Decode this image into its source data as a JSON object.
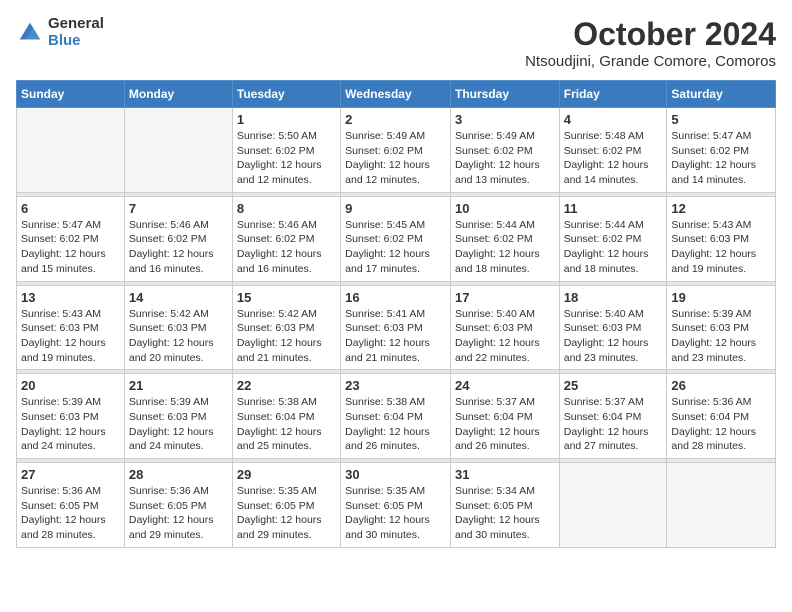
{
  "header": {
    "logo_general": "General",
    "logo_blue": "Blue",
    "month_title": "October 2024",
    "location": "Ntsoudjini, Grande Comore, Comoros"
  },
  "weekdays": [
    "Sunday",
    "Monday",
    "Tuesday",
    "Wednesday",
    "Thursday",
    "Friday",
    "Saturday"
  ],
  "weeks": [
    [
      {
        "day": "",
        "info": ""
      },
      {
        "day": "",
        "info": ""
      },
      {
        "day": "1",
        "info": "Sunrise: 5:50 AM\nSunset: 6:02 PM\nDaylight: 12 hours and 12 minutes."
      },
      {
        "day": "2",
        "info": "Sunrise: 5:49 AM\nSunset: 6:02 PM\nDaylight: 12 hours and 12 minutes."
      },
      {
        "day": "3",
        "info": "Sunrise: 5:49 AM\nSunset: 6:02 PM\nDaylight: 12 hours and 13 minutes."
      },
      {
        "day": "4",
        "info": "Sunrise: 5:48 AM\nSunset: 6:02 PM\nDaylight: 12 hours and 14 minutes."
      },
      {
        "day": "5",
        "info": "Sunrise: 5:47 AM\nSunset: 6:02 PM\nDaylight: 12 hours and 14 minutes."
      }
    ],
    [
      {
        "day": "6",
        "info": "Sunrise: 5:47 AM\nSunset: 6:02 PM\nDaylight: 12 hours and 15 minutes."
      },
      {
        "day": "7",
        "info": "Sunrise: 5:46 AM\nSunset: 6:02 PM\nDaylight: 12 hours and 16 minutes."
      },
      {
        "day": "8",
        "info": "Sunrise: 5:46 AM\nSunset: 6:02 PM\nDaylight: 12 hours and 16 minutes."
      },
      {
        "day": "9",
        "info": "Sunrise: 5:45 AM\nSunset: 6:02 PM\nDaylight: 12 hours and 17 minutes."
      },
      {
        "day": "10",
        "info": "Sunrise: 5:44 AM\nSunset: 6:02 PM\nDaylight: 12 hours and 18 minutes."
      },
      {
        "day": "11",
        "info": "Sunrise: 5:44 AM\nSunset: 6:02 PM\nDaylight: 12 hours and 18 minutes."
      },
      {
        "day": "12",
        "info": "Sunrise: 5:43 AM\nSunset: 6:03 PM\nDaylight: 12 hours and 19 minutes."
      }
    ],
    [
      {
        "day": "13",
        "info": "Sunrise: 5:43 AM\nSunset: 6:03 PM\nDaylight: 12 hours and 19 minutes."
      },
      {
        "day": "14",
        "info": "Sunrise: 5:42 AM\nSunset: 6:03 PM\nDaylight: 12 hours and 20 minutes."
      },
      {
        "day": "15",
        "info": "Sunrise: 5:42 AM\nSunset: 6:03 PM\nDaylight: 12 hours and 21 minutes."
      },
      {
        "day": "16",
        "info": "Sunrise: 5:41 AM\nSunset: 6:03 PM\nDaylight: 12 hours and 21 minutes."
      },
      {
        "day": "17",
        "info": "Sunrise: 5:40 AM\nSunset: 6:03 PM\nDaylight: 12 hours and 22 minutes."
      },
      {
        "day": "18",
        "info": "Sunrise: 5:40 AM\nSunset: 6:03 PM\nDaylight: 12 hours and 23 minutes."
      },
      {
        "day": "19",
        "info": "Sunrise: 5:39 AM\nSunset: 6:03 PM\nDaylight: 12 hours and 23 minutes."
      }
    ],
    [
      {
        "day": "20",
        "info": "Sunrise: 5:39 AM\nSunset: 6:03 PM\nDaylight: 12 hours and 24 minutes."
      },
      {
        "day": "21",
        "info": "Sunrise: 5:39 AM\nSunset: 6:03 PM\nDaylight: 12 hours and 24 minutes."
      },
      {
        "day": "22",
        "info": "Sunrise: 5:38 AM\nSunset: 6:04 PM\nDaylight: 12 hours and 25 minutes."
      },
      {
        "day": "23",
        "info": "Sunrise: 5:38 AM\nSunset: 6:04 PM\nDaylight: 12 hours and 26 minutes."
      },
      {
        "day": "24",
        "info": "Sunrise: 5:37 AM\nSunset: 6:04 PM\nDaylight: 12 hours and 26 minutes."
      },
      {
        "day": "25",
        "info": "Sunrise: 5:37 AM\nSunset: 6:04 PM\nDaylight: 12 hours and 27 minutes."
      },
      {
        "day": "26",
        "info": "Sunrise: 5:36 AM\nSunset: 6:04 PM\nDaylight: 12 hours and 28 minutes."
      }
    ],
    [
      {
        "day": "27",
        "info": "Sunrise: 5:36 AM\nSunset: 6:05 PM\nDaylight: 12 hours and 28 minutes."
      },
      {
        "day": "28",
        "info": "Sunrise: 5:36 AM\nSunset: 6:05 PM\nDaylight: 12 hours and 29 minutes."
      },
      {
        "day": "29",
        "info": "Sunrise: 5:35 AM\nSunset: 6:05 PM\nDaylight: 12 hours and 29 minutes."
      },
      {
        "day": "30",
        "info": "Sunrise: 5:35 AM\nSunset: 6:05 PM\nDaylight: 12 hours and 30 minutes."
      },
      {
        "day": "31",
        "info": "Sunrise: 5:34 AM\nSunset: 6:05 PM\nDaylight: 12 hours and 30 minutes."
      },
      {
        "day": "",
        "info": ""
      },
      {
        "day": "",
        "info": ""
      }
    ]
  ]
}
